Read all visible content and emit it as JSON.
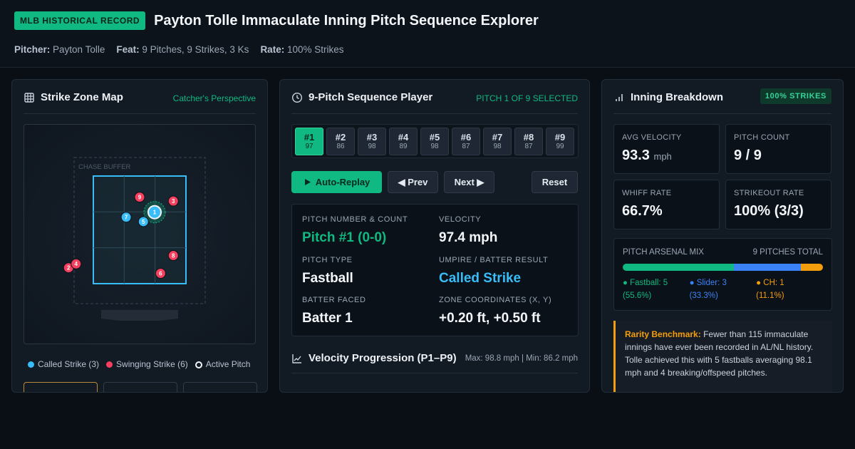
{
  "header": {
    "badge": "MLB HISTORICAL RECORD",
    "title": "Payton Tolle Immaculate Inning Pitch Sequence Explorer",
    "pitcher_label": "Pitcher:",
    "pitcher_value": "Payton Tolle",
    "feat_label": "Feat:",
    "feat_value": "9 Pitches, 9 Strikes, 3 Ks",
    "rate_label": "Rate:",
    "rate_value": "100% Strikes"
  },
  "zone_panel": {
    "title": "Strike Zone Map",
    "perspective": "Catcher's Perspective",
    "chase_label": "CHASE BUFFER",
    "legend": {
      "called": "Called Strike (3)",
      "swinging": "Swinging Strike (6)",
      "active": "Active Pitch"
    },
    "pitches": [
      {
        "n": "1",
        "type": "called",
        "x": 0.2,
        "z": 2.85
      },
      {
        "n": "2",
        "type": "swinging",
        "x": -0.95,
        "z": 1.85
      },
      {
        "n": "3",
        "type": "swinging",
        "x": 0.45,
        "z": 3.05
      },
      {
        "n": "4",
        "type": "swinging",
        "x": -0.85,
        "z": 1.92
      },
      {
        "n": "5",
        "type": "called",
        "x": 0.05,
        "z": 2.68
      },
      {
        "n": "6",
        "type": "swinging",
        "x": 0.28,
        "z": 1.75
      },
      {
        "n": "7",
        "type": "called",
        "x": -0.18,
        "z": 2.76
      },
      {
        "n": "8",
        "type": "swinging",
        "x": 0.45,
        "z": 2.07
      },
      {
        "n": "9",
        "type": "swinging",
        "x": 0.0,
        "z": 3.12
      }
    ]
  },
  "sequence_panel": {
    "title": "9-Pitch Sequence Player",
    "selected_status": "PITCH 1 OF 9 SELECTED",
    "pitches": [
      {
        "label": "#1",
        "velo": "97"
      },
      {
        "label": "#2",
        "velo": "86"
      },
      {
        "label": "#3",
        "velo": "98"
      },
      {
        "label": "#4",
        "velo": "89"
      },
      {
        "label": "#5",
        "velo": "98"
      },
      {
        "label": "#6",
        "velo": "87"
      },
      {
        "label": "#7",
        "velo": "98"
      },
      {
        "label": "#8",
        "velo": "87"
      },
      {
        "label": "#9",
        "velo": "99"
      }
    ],
    "buttons": {
      "auto": "Auto-Replay",
      "prev": "◀ Prev",
      "next": "Next ▶",
      "reset": "Reset"
    },
    "detail": {
      "count_label": "PITCH NUMBER & COUNT",
      "count_value": "Pitch #1 (0-0)",
      "velocity_label": "VELOCITY",
      "velocity_value": "97.4 mph",
      "type_label": "PITCH TYPE",
      "type_value": "Fastball",
      "result_label": "UMPIRE / BATTER RESULT",
      "result_value": "Called Strike",
      "batter_label": "BATTER FACED",
      "batter_value": "Batter 1",
      "coords_label": "ZONE COORDINATES (X, Y)",
      "coords_value": "+0.20 ft, +0.50 ft"
    },
    "velo_title": "Velocity Progression (P1–P9)",
    "velo_meta": "Max: 98.8 mph | Min: 86.2 mph"
  },
  "breakdown_panel": {
    "title": "Inning Breakdown",
    "badge": "100% STRIKES",
    "stats": {
      "avg_velo_label": "AVG VELOCITY",
      "avg_velo_value": "93.3",
      "avg_velo_unit": "mph",
      "pitch_count_label": "PITCH COUNT",
      "pitch_count_value": "9 / 9",
      "whiff_label": "WHIFF RATE",
      "whiff_value": "66.7%",
      "k_label": "STRIKEOUT RATE",
      "k_value": "100% (3/3)"
    },
    "arsenal": {
      "title": "PITCH ARSENAL MIX",
      "total": "9 PITCHES TOTAL",
      "mix": [
        {
          "name": "● Fastball: 5",
          "pct_text": "(55.6%)",
          "share": 0.556,
          "color": "#10b981"
        },
        {
          "name": "● Slider: 3",
          "pct_text": "(33.3%)",
          "share": 0.333,
          "color": "#3b82f6"
        },
        {
          "name": "● CH: 1",
          "pct_text": "(11.1%)",
          "share": 0.111,
          "color": "#f59e0b"
        }
      ]
    },
    "rarity": {
      "label": "Rarity Benchmark:",
      "text": "Fewer than 115 immaculate innings have ever been recorded in AL/NL history. Tolle achieved this with 5 fastballs averaging 98.1 mph and 4 breaking/offspeed pitches."
    }
  },
  "colors": {
    "accent": "#10b981",
    "called": "#38bdf8",
    "swinging": "#f43f5e",
    "warning": "#f59e0b"
  }
}
